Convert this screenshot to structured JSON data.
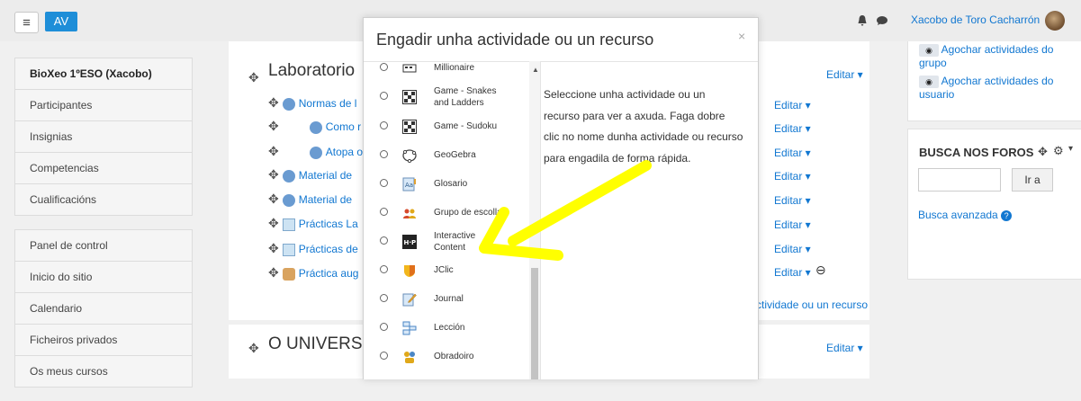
{
  "navbar": {
    "menu_icon": "menu-icon",
    "av_label": "AV",
    "user_name": "Xacobo de Toro Cacharrón"
  },
  "left_nav": {
    "course_items": [
      "BioXeo 1ºESO (Xacobo)",
      "Participantes",
      "Insignias",
      "Competencias",
      "Cualificacións"
    ],
    "site_items": [
      "Panel de control",
      "Inicio do sitio",
      "Calendario",
      "Ficheiros privados",
      "Os meus cursos"
    ]
  },
  "course": {
    "section1_title": "Laboratorio",
    "section2_title": "O UNIVERSO",
    "activities": [
      "Normas de l",
      "Como r",
      "Atopa o",
      "Material de",
      "Material de",
      "Prácticas La",
      "Prácticas de",
      "Práctica aug"
    ],
    "edit_label": "Editar ▾",
    "add_link": "ctividade ou un recurso"
  },
  "right_col": {
    "hide_group": "Agochar actividades do grupo",
    "hide_user": "Agochar actividades do usuario",
    "forum_title": "BUSCA NOS FOROS",
    "go_button": "Ir a",
    "advanced_search": "Busca avanzada"
  },
  "modal": {
    "title": "Engadir unha actividade ou un recurso",
    "close": "×",
    "options": [
      {
        "label": "Millionaire",
        "icon": "millionaire-icon"
      },
      {
        "label": "Game - Snakes and Ladders",
        "icon": "game-board-icon"
      },
      {
        "label": "Game - Sudoku",
        "icon": "game-board-icon"
      },
      {
        "label": "GeoGebra",
        "icon": "geogebra-icon"
      },
      {
        "label": "Glosario",
        "icon": "glossary-icon"
      },
      {
        "label": "Grupo de escolla",
        "icon": "group-icon"
      },
      {
        "label": "Interactive Content",
        "icon": "h5p-icon"
      },
      {
        "label": "JClic",
        "icon": "jclic-icon"
      },
      {
        "label": "Journal",
        "icon": "journal-icon"
      },
      {
        "label": "Lección",
        "icon": "lesson-icon"
      },
      {
        "label": "Obradoiro",
        "icon": "workshop-icon"
      }
    ],
    "help_text": "Seleccione unha actividade ou un recurso para ver a axuda. Faga dobre clic no nome dunha actividade ou recurso para engadila de forma rápida."
  },
  "colors": {
    "link": "#1177d1",
    "accent": "#1e8ed8",
    "annotation": "#ffff00"
  }
}
